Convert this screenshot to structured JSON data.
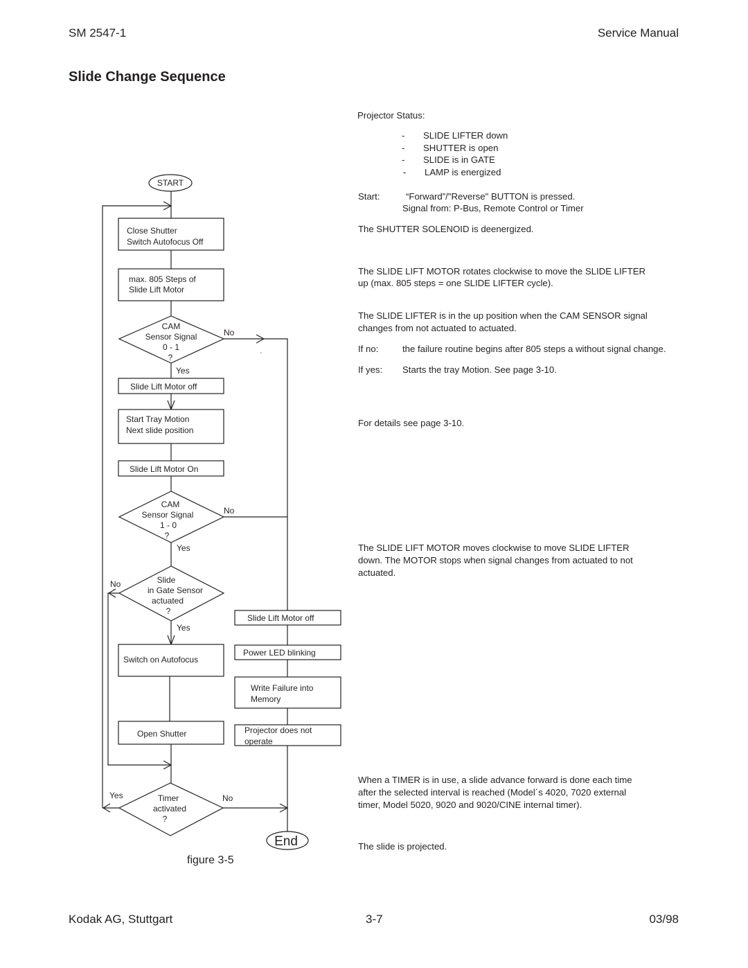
{
  "header": {
    "doc_number": "SM 2547-1",
    "doc_type": "Service Manual"
  },
  "page_title": "Slide Change Sequence",
  "flowchart": {
    "start": "START",
    "end": "End",
    "figure_caption": "figure 3-5",
    "boxes": {
      "close_shutter": [
        "Close Shutter",
        "Switch Autofocus Off"
      ],
      "max_steps": [
        "max. 805 Steps of",
        "Slide Lift Motor"
      ],
      "motor_off_1": [
        "Slide Lift Motor off"
      ],
      "start_tray": [
        "Start Tray Motion",
        "Next slide position"
      ],
      "motor_on": [
        "Slide Lift Motor On"
      ],
      "switch_autofocus": [
        "Switch on Autofocus"
      ],
      "open_shutter": [
        "Open Shutter"
      ],
      "motor_off_2": [
        "Slide Lift Motor off"
      ],
      "power_led": [
        "Power LED blinking"
      ],
      "write_failure": [
        "Write Failure into",
        "Memory"
      ],
      "projector_not_operate": [
        "Projector does not",
        "operate"
      ]
    },
    "decisions": {
      "cam_0_1": [
        "CAM",
        "Sensor Signal",
        "0  -  1",
        "?"
      ],
      "cam_1_0": [
        "CAM",
        "Sensor Signal",
        "1 - 0",
        "?"
      ],
      "slide_gate": [
        "Slide",
        "in Gate Sensor",
        "actuated",
        "?"
      ],
      "timer": [
        "Timer",
        "activated",
        "?"
      ]
    },
    "labels": {
      "yes": "Yes",
      "no": "No"
    }
  },
  "description": {
    "projector_status_label": "Projector Status:",
    "status_items": [
      {
        "bullet": "-",
        "text": "SLIDE LIFTER down"
      },
      {
        "bullet": "-",
        "text": "SHUTTER is open"
      },
      {
        "bullet": "-",
        "text": "SLIDE is in GATE"
      },
      {
        "bullet": "-",
        "text": "LAMP is energized"
      }
    ],
    "start_label": "Start:",
    "start_line1": "“Forward”/\"Reverse\" BUTTON is pressed.",
    "start_line2": "Signal from: P-Bus, Remote Control or Timer",
    "shutter_solenoid": "The SHUTTER SOLENOID is deenergized.",
    "lift_motor_up": [
      "The SLIDE LIFT MOTOR rotates clockwise to move the SLIDE LIFTER",
      "up  (max. 805 steps = one SLIDE LIFTER cycle)."
    ],
    "lifter_up_position": [
      "The SLIDE LIFTER is in the up position when the CAM SENSOR signal",
      "changes from not actuated to actuated."
    ],
    "if_no_label": "If no:",
    "if_no_text": "the failure routine begins after 805 steps a without signal change.",
    "if_yes_label": "If yes:",
    "if_yes_text": "Starts the tray Motion. See page 3-10.",
    "details": "For details see page 3-10.",
    "lift_motor_down": [
      "The SLIDE LIFT MOTOR moves clockwise to move SLIDE LIFTER",
      "down. The MOTOR stops when signal changes from actuated to not",
      "actuated."
    ],
    "timer_note": [
      "When a TIMER is  in use, a slide advance forward is done each time",
      "after the selected interval is reached (Model´s 4020, 7020 external",
      "timer, Model 5020, 9020 and 9020/CINE internal timer)."
    ],
    "projected": "The slide is projected."
  },
  "footer": {
    "company": "Kodak AG, Stuttgart",
    "page": "3-7",
    "date": "03/98"
  }
}
